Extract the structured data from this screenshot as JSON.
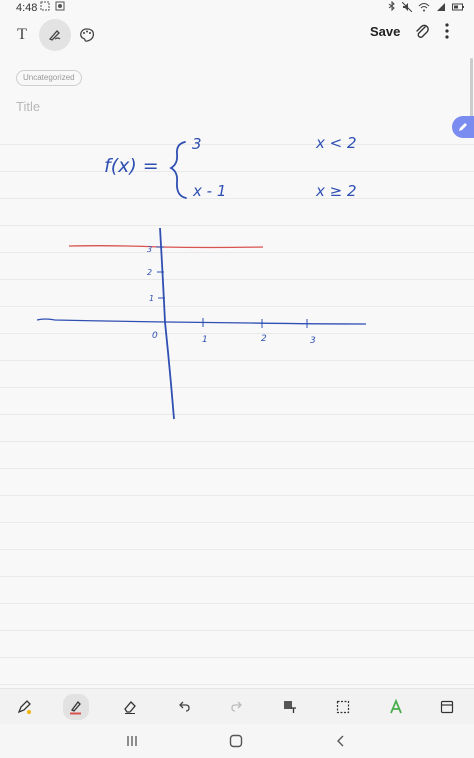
{
  "status_bar": {
    "time": "4:48"
  },
  "toolbar": {
    "text_mode_label": "T",
    "save_label": "Save"
  },
  "note": {
    "category": "Uncategorized",
    "title_placeholder": "Title"
  },
  "handwriting": {
    "function_lhs": "f(x) =",
    "case1_value": "3",
    "case1_condition": "x < 2",
    "case2_value": "x - 1",
    "case2_condition": "x ≥ 2",
    "origin_label": "0",
    "y_tick_labels": [
      "3",
      "2",
      "1"
    ],
    "x_tick_labels": [
      "1",
      "2",
      "3"
    ]
  },
  "colors": {
    "ink_blue": "#2f4fb3",
    "ink_red": "#d9534f",
    "accent": "#7a8cf0"
  },
  "icons": {
    "text": "text-mode-icon",
    "pen": "pen-mode-icon",
    "palette": "palette-icon",
    "attach": "paperclip-icon",
    "more": "more-vertical-icon"
  }
}
